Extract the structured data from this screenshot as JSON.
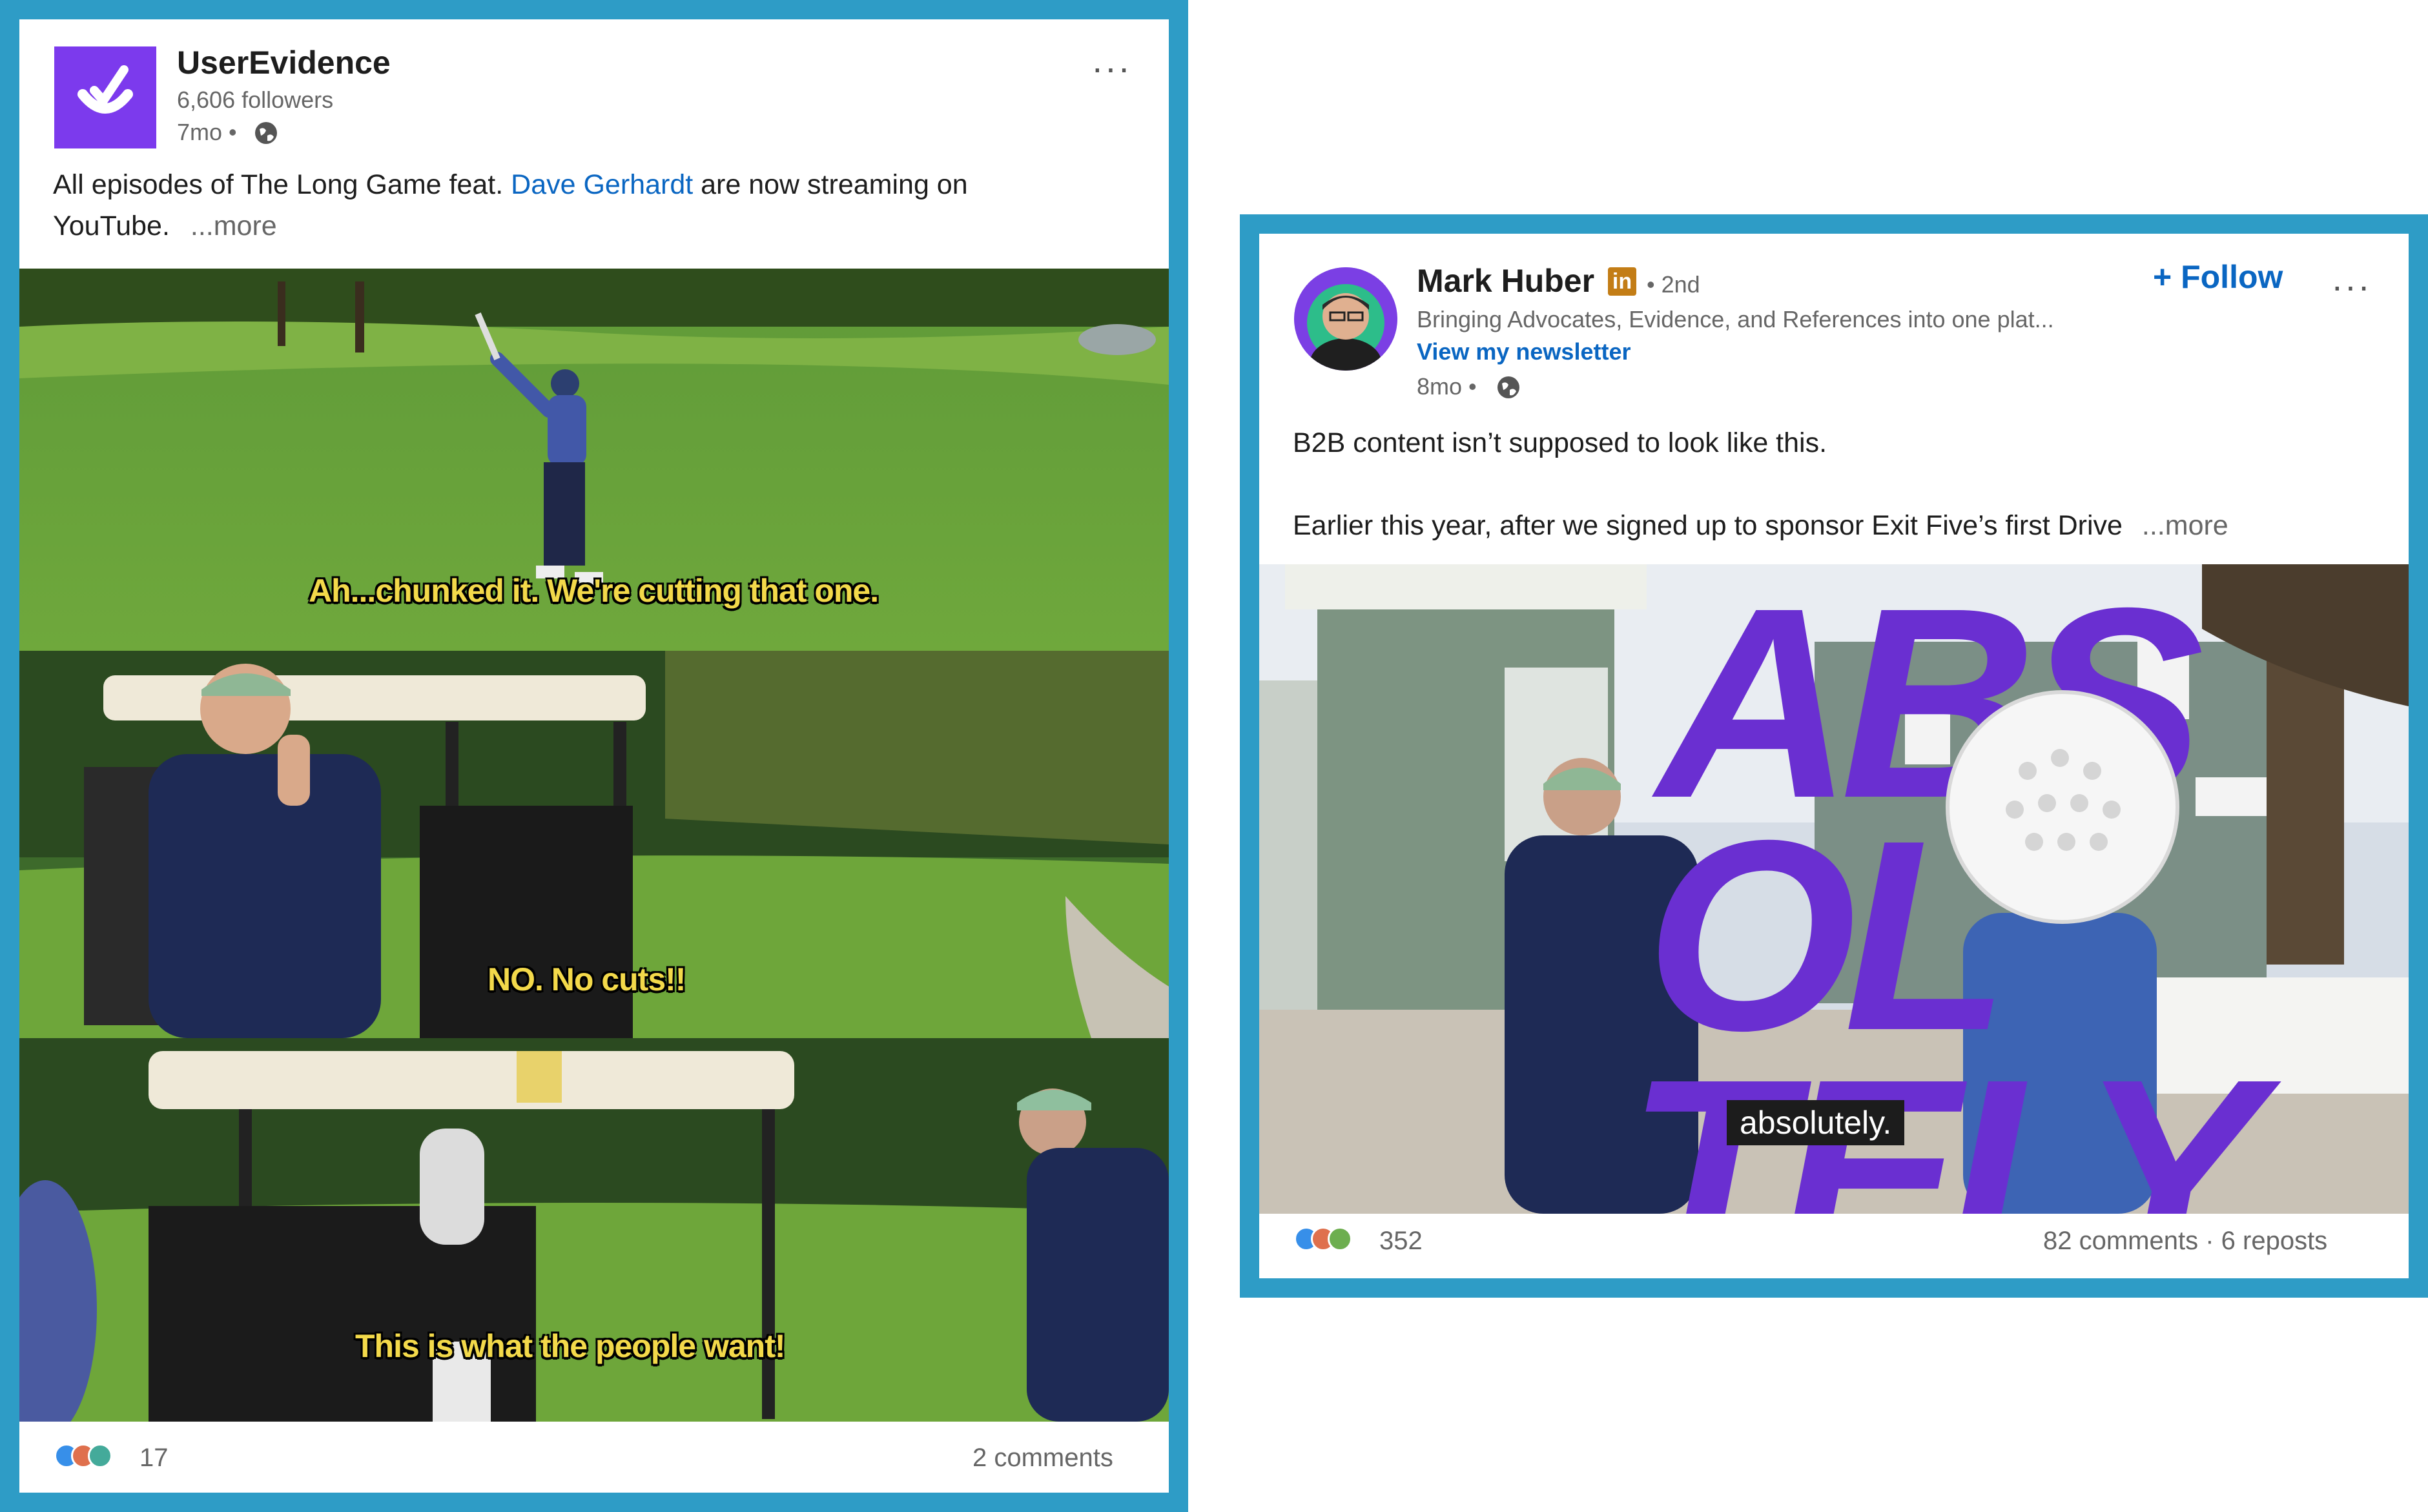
{
  "post1": {
    "author_name": "UserEvidence",
    "followers": "6,606 followers",
    "age": "7mo •",
    "body_text_1": "All episodes of The Long Game feat. ",
    "body_link": "Dave Gerhardt",
    "body_text_2": " are now streaming on",
    "body_text_3": "YouTube.",
    "more_label": "...more",
    "menu_label": "···",
    "captions": [
      "Ah...chunked it. We're cutting that one.",
      "NO. No cuts!!",
      "This is what the people want!"
    ],
    "reaction_count": "17",
    "comments": "2 comments",
    "brand_color": "#7c3aed"
  },
  "post2": {
    "author_name": "Mark Huber",
    "linkedin_badge": "in",
    "connection": "• 2nd",
    "headline": "Bringing Advocates, Evidence, and References into one plat...",
    "newsletter_link": "View my newsletter",
    "age": "8mo •",
    "follow_label": "+ Follow",
    "menu_label": "···",
    "body_line_1": "B2B content isn’t supposed to look like this.",
    "body_line_2": "Earlier this year, after we signed up to sponsor Exit Five’s first Drive",
    "more_label": "...more",
    "video_caption": "absolutely.",
    "overlay_letters": [
      "ABS",
      "OL",
      "TELY"
    ],
    "reaction_count": "352",
    "engagement": "82 comments · 6 reposts",
    "accent_color": "#6a2fd1"
  },
  "frame_color": "#2e9cc6"
}
